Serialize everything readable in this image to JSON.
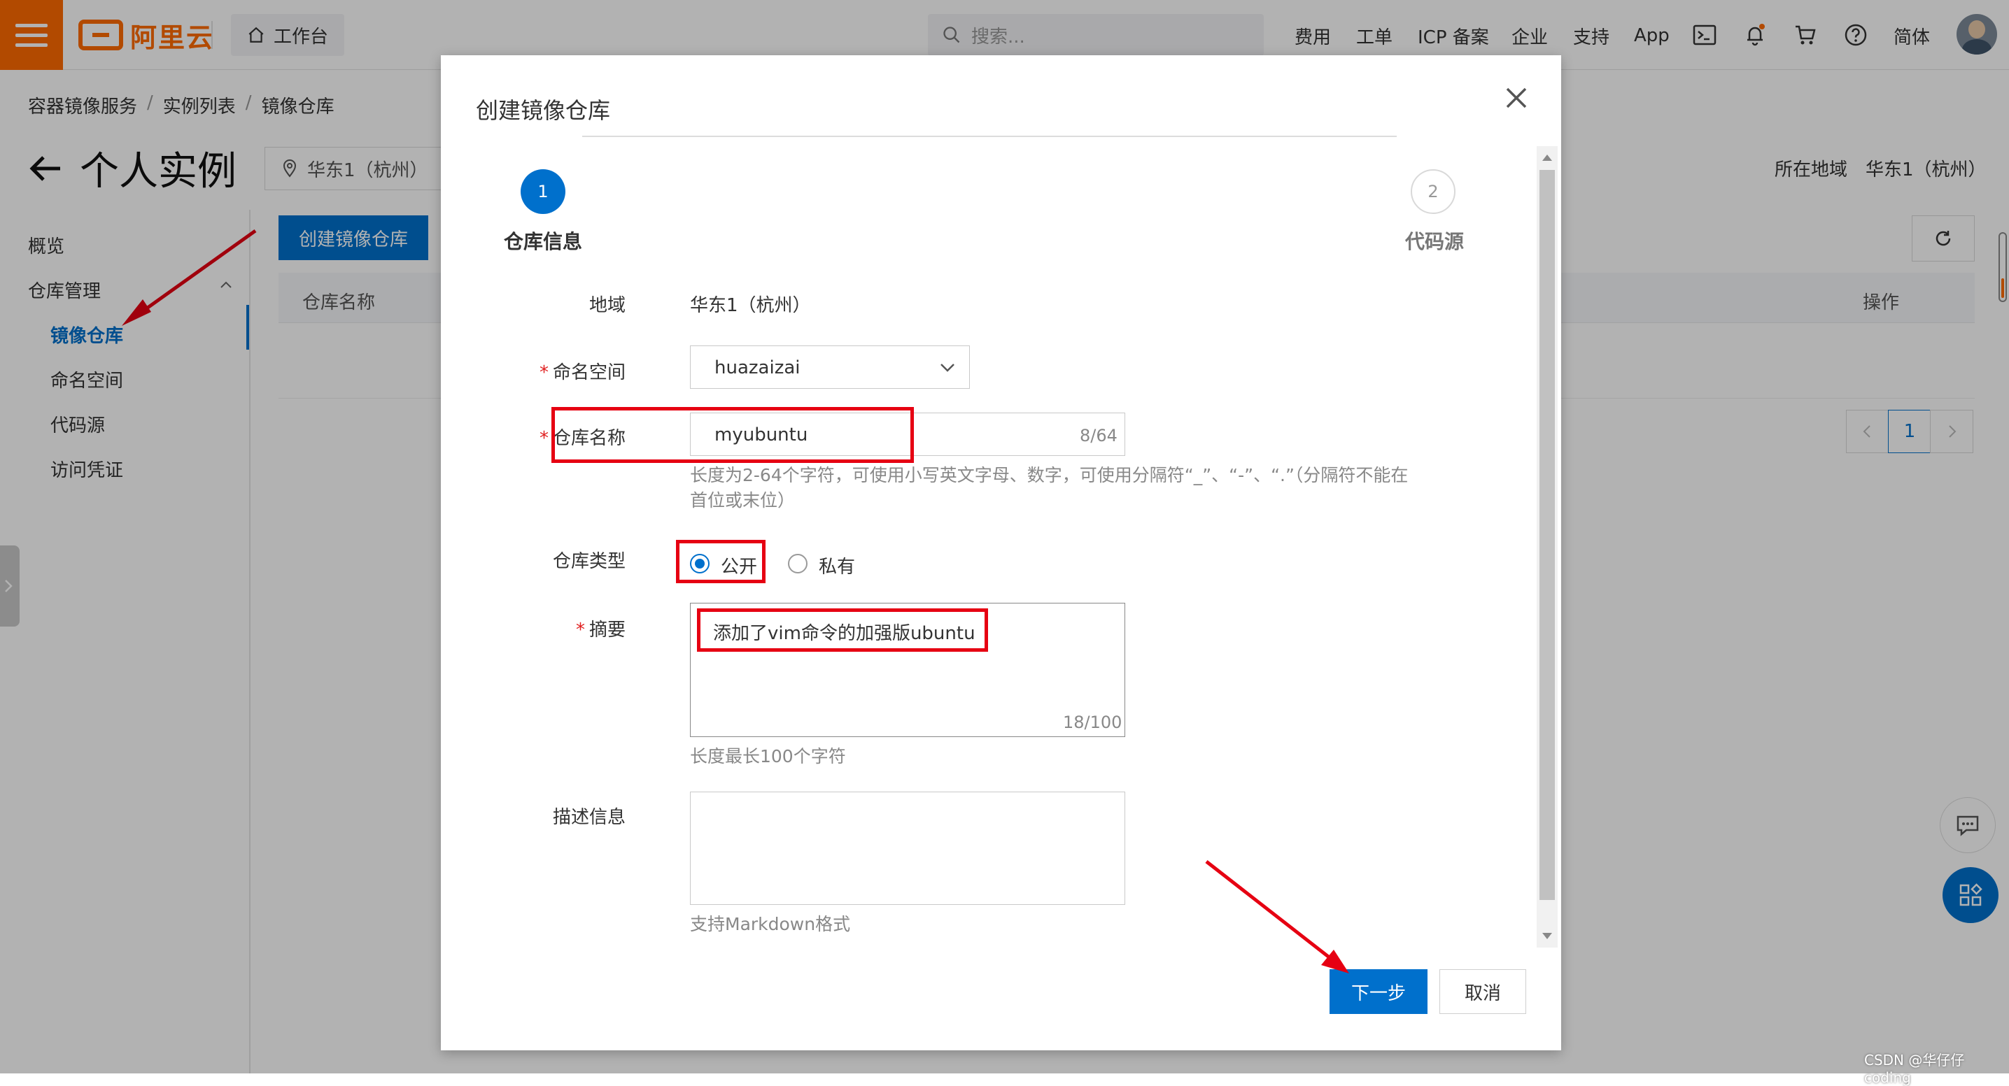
{
  "header": {
    "brand": "阿里云",
    "workbench": "工作台",
    "search_placeholder": "搜索...",
    "nav": [
      "费用",
      "工单",
      "ICP 备案",
      "企业",
      "支持",
      "App"
    ],
    "lang": "简体",
    "icons": [
      "terminal-icon",
      "bell-icon",
      "cart-icon",
      "help-icon"
    ],
    "brand_color": "#ff6a00"
  },
  "breadcrumb": [
    "容器镜像服务",
    "实例列表",
    "镜像仓库"
  ],
  "page": {
    "title": "个人实例",
    "region": "华东1（杭州）",
    "location_label": "所在地域",
    "location_value": "华东1（杭州）"
  },
  "sidebar": {
    "overview": "概览",
    "group": "仓库管理",
    "items": [
      {
        "label": "镜像仓库",
        "active": true
      },
      {
        "label": "命名空间",
        "active": false
      },
      {
        "label": "代码源",
        "active": false
      },
      {
        "label": "访问凭证",
        "active": false
      }
    ]
  },
  "main": {
    "create_button": "创建镜像仓库",
    "table_headers": [
      "仓库名称",
      "操作"
    ],
    "current_page": "1"
  },
  "modal": {
    "title": "创建镜像仓库",
    "steps": [
      {
        "number": "1",
        "label": "仓库信息",
        "active": true
      },
      {
        "number": "2",
        "label": "代码源",
        "active": false
      }
    ],
    "fields": {
      "region": {
        "label": "地域",
        "value": "华东1（杭州）"
      },
      "namespace": {
        "label": "命名空间",
        "value": "huazaizai"
      },
      "repo_name": {
        "label": "仓库名称",
        "value": "myubuntu",
        "counter": "8/64",
        "hint": "长度为2-64个字符，可使用小写英文字母、数字，可使用分隔符“_”、“-”、“.”（分隔符不能在首位或末位）"
      },
      "repo_type": {
        "label": "仓库类型",
        "options": [
          {
            "label": "公开",
            "selected": true
          },
          {
            "label": "私有",
            "selected": false
          }
        ]
      },
      "summary": {
        "label": "摘要",
        "value": "添加了vim命令的加强版ubuntu",
        "counter": "18/100",
        "hint": "长度最长100个字符"
      },
      "description": {
        "label": "描述信息",
        "value": "",
        "hint": "支持Markdown格式"
      }
    },
    "next_button": "下一步",
    "cancel_button": "取消"
  },
  "watermark": "CSDN @华仔仔coding",
  "colors": {
    "primary": "#0070cc",
    "annotation": "#e60012"
  }
}
